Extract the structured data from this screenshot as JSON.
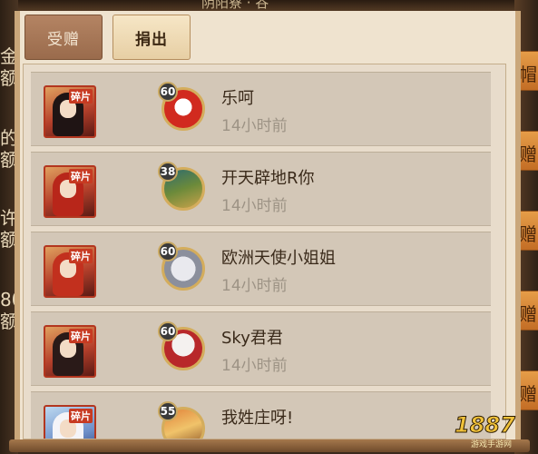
{
  "side_left": [
    "金",
    "额",
    "的",
    "额",
    "许",
    "额",
    "80",
    "额"
  ],
  "side_right": [
    "帽子",
    "赠子",
    "赠子",
    "赠子",
    "赠子"
  ],
  "top_text": "阴阳寮 · 谷",
  "tabs": {
    "receive": "受赠",
    "donate": "捐出"
  },
  "card_badge": "碎片",
  "records": [
    {
      "level": "60",
      "name": "乐呵",
      "time": "14小时前"
    },
    {
      "level": "38",
      "name": "开天辟地R你",
      "time": "14小时前"
    },
    {
      "level": "60",
      "name": "欧洲天使小姐姐",
      "time": "14小时前"
    },
    {
      "level": "60",
      "name": "Sky君君",
      "time": "14小时前"
    },
    {
      "level": "55",
      "name": "我姓庄呀!",
      "time": ""
    }
  ],
  "watermark": {
    "number": "1887",
    "site": "游戏手游网"
  },
  "colors": {
    "panel": "#efe3cf",
    "row": "#d3c7b7",
    "accent": "#c73a22"
  }
}
